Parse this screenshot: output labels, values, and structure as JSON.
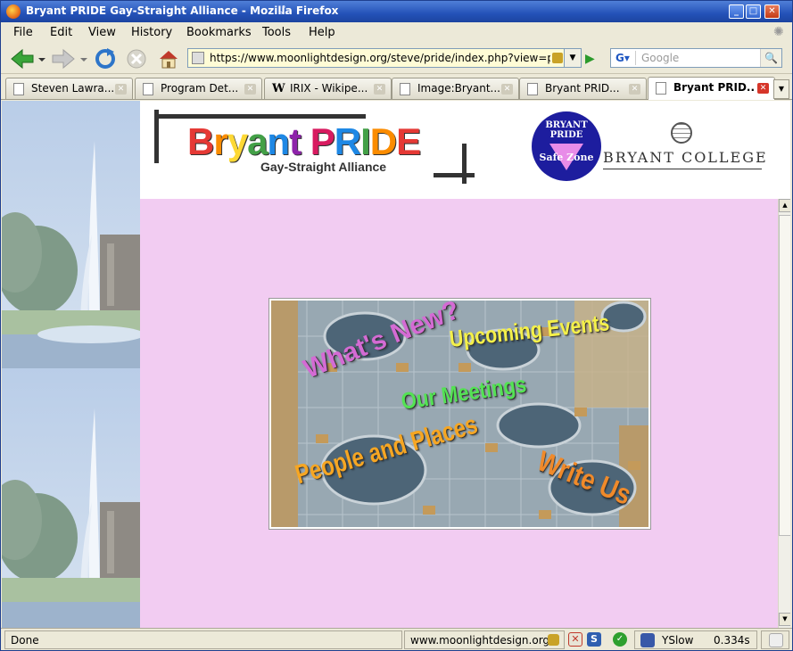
{
  "window": {
    "title": "Bryant PRIDE Gay-Straight Alliance - Mozilla Firefox"
  },
  "menu": [
    "File",
    "Edit",
    "View",
    "History",
    "Bookmarks",
    "Tools",
    "Help"
  ],
  "toolbar": {
    "url": "https://www.moonlightdesign.org/steve/pride/index.php?view=pec",
    "search_placeholder": "Google"
  },
  "tabs": [
    {
      "label": "Steven Lawra...",
      "icon": "page-icon",
      "active": false
    },
    {
      "label": "Program Det...",
      "icon": "page-icon",
      "active": false
    },
    {
      "label": "IRIX - Wikipe...",
      "icon": "wikipedia-icon",
      "active": false
    },
    {
      "label": "Image:Bryant...",
      "icon": "page-icon",
      "active": false
    },
    {
      "label": "Bryant PRID...",
      "icon": "page-icon",
      "active": false
    },
    {
      "label": "Bryant PRID...",
      "icon": "page-icon",
      "active": true
    }
  ],
  "page": {
    "logo_text": "Bryant PRIDE",
    "logo_subtitle": "Gay-Straight Alliance",
    "safe_zone_top": "BRYANT PRIDE",
    "safe_zone_bottom": "Safe Zone",
    "college_logo_text": "BRYANT COLLEGE",
    "links": {
      "whats_new": "What's New?",
      "upcoming_events": "Upcoming Events",
      "our_meetings": "Our Meetings",
      "people_places": "People and Places",
      "write_us": "Write Us"
    },
    "colors": {
      "background": "#f2ccf2",
      "whats_new": "#d46bd4",
      "upcoming_events": "#f4f04a",
      "our_meetings": "#54e254",
      "people_places": "#f6a623",
      "write_us": "#f08a2a"
    }
  },
  "statusbar": {
    "status": "Done",
    "site": "www.moonlightdesign.org",
    "yslow_label": "YSlow",
    "yslow_time": "0.334s"
  }
}
